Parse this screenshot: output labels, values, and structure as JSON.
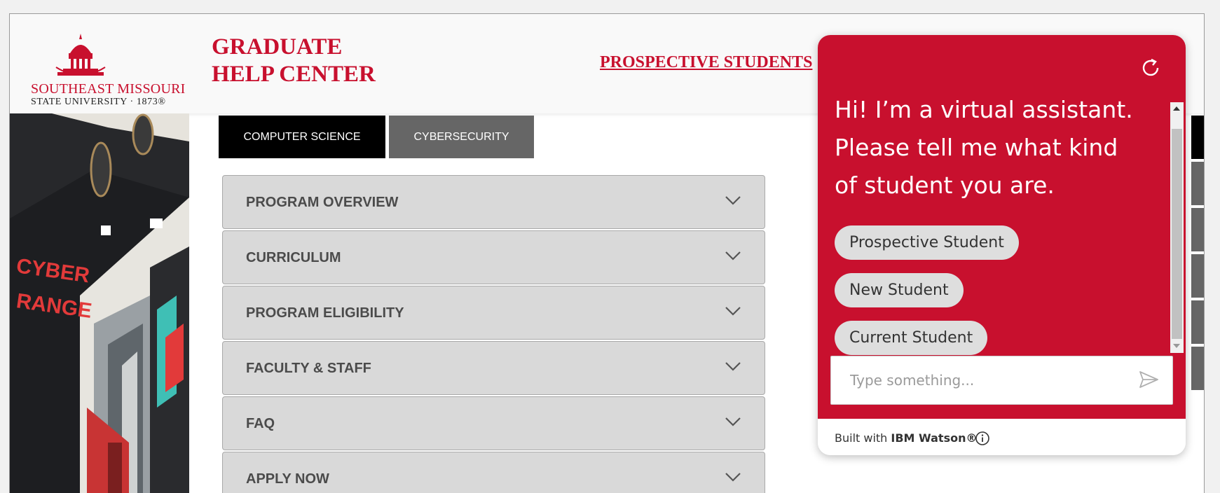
{
  "header": {
    "logo": {
      "name_line1": "SOUTHEAST MISSOURI",
      "name_line2": "STATE UNIVERSITY · 1873®"
    },
    "site_title": "GRADUATE HELP CENTER",
    "nav_link": "PROSPECTIVE STUDENTS"
  },
  "hero": {
    "sign_text": "CYBER RANGE"
  },
  "tabs": [
    {
      "label": "COMPUTER SCIENCE",
      "active": true
    },
    {
      "label": "CYBERSECURITY",
      "active": false
    }
  ],
  "accordion": [
    {
      "label": "PROGRAM OVERVIEW"
    },
    {
      "label": "CURRICULUM"
    },
    {
      "label": "PROGRAM ELIGIBILITY"
    },
    {
      "label": "FACULTY & STAFF"
    },
    {
      "label": "FAQ"
    },
    {
      "label": "APPLY NOW"
    }
  ],
  "chat": {
    "message": "Hi! I’m a virtual assistant. Please tell me what kind of student you are.",
    "options": [
      "Prospective Student",
      "New Student",
      "Current Student"
    ],
    "input_placeholder": "Type something...",
    "footer_prefix": "Built with ",
    "footer_brand": "IBM Watson®"
  },
  "colors": {
    "brand_red": "#c8102e",
    "tab_active": "#000000",
    "tab_inactive": "#666666",
    "accordion_bg": "#d9d9d9"
  },
  "icons": {
    "refresh": "refresh-icon",
    "send": "send-icon",
    "info": "info-icon",
    "chevron": "chevron-down-icon"
  }
}
